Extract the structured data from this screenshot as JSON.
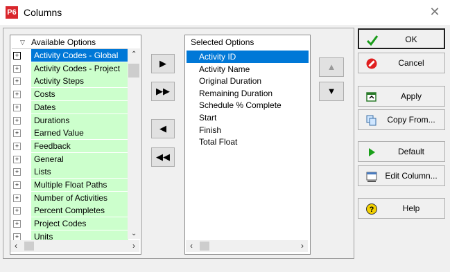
{
  "window": {
    "title": "Columns",
    "app_icon_text": "P6",
    "close_glyph": "✕"
  },
  "available": {
    "header": "Available Options",
    "items": [
      {
        "label": "Activity Codes - Global",
        "expander": "+",
        "selected": true
      },
      {
        "label": "Activity Codes - Project",
        "expander": "+"
      },
      {
        "label": "Activity Steps",
        "expander": "+"
      },
      {
        "label": "Costs",
        "expander": "+"
      },
      {
        "label": "Dates",
        "expander": "+"
      },
      {
        "label": "Durations",
        "expander": "+"
      },
      {
        "label": "Earned Value",
        "expander": "+"
      },
      {
        "label": "Feedback",
        "expander": "+"
      },
      {
        "label": "General",
        "expander": "+"
      },
      {
        "label": "Lists",
        "expander": "+"
      },
      {
        "label": "Multiple Float Paths",
        "expander": "+"
      },
      {
        "label": "Number of Activities",
        "expander": "+"
      },
      {
        "label": "Percent Completes",
        "expander": "+"
      },
      {
        "label": "Project Codes",
        "expander": "+"
      },
      {
        "label": "Units",
        "expander": "+"
      }
    ]
  },
  "move": {
    "add": "▶",
    "add_all": "▶▶",
    "remove": "◀",
    "remove_all": "◀◀"
  },
  "selected": {
    "header": "Selected Options",
    "items": [
      {
        "label": "Activity ID",
        "selected": true
      },
      {
        "label": "Activity Name"
      },
      {
        "label": "Original Duration"
      },
      {
        "label": "Remaining Duration"
      },
      {
        "label": "Schedule % Complete"
      },
      {
        "label": "Start"
      },
      {
        "label": "Finish"
      },
      {
        "label": "Total Float"
      }
    ]
  },
  "order": {
    "up": "▲",
    "down": "▼"
  },
  "buttons": {
    "ok": "OK",
    "cancel": "Cancel",
    "apply": "Apply",
    "copy_from": "Copy From...",
    "default": "Default",
    "edit_column": "Edit Column...",
    "help": "Help"
  },
  "colors": {
    "accent": "#0078d7",
    "option_bg": "#ccffcc",
    "brand": "#d9262c"
  }
}
